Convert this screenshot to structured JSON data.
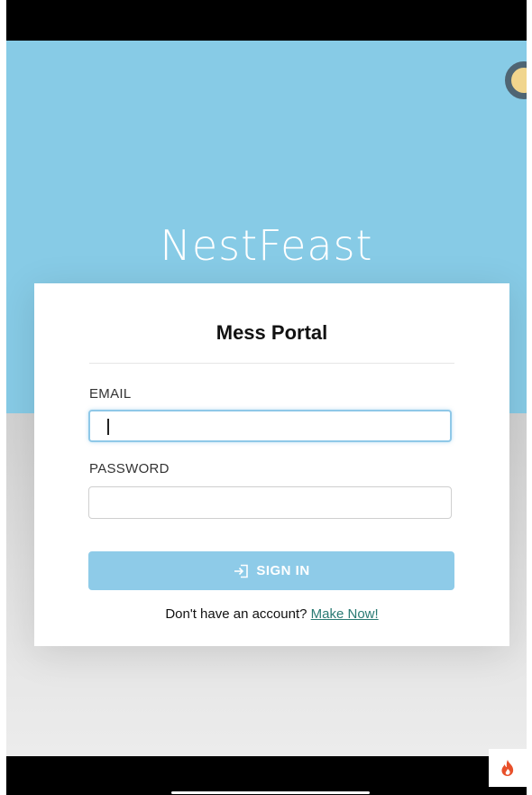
{
  "app": {
    "title": "NestFeast"
  },
  "login": {
    "heading": "Mess Portal",
    "email_label": "EMAIL",
    "email_value": "",
    "password_label": "PASSWORD",
    "password_value": "",
    "signin_label": "SIGN IN",
    "signup_prompt": "Don't have an account?",
    "signup_link": "Make Now!"
  },
  "icons": {
    "signin": "login-arrow-icon",
    "fab": "flame-icon",
    "avatar": "avatar"
  },
  "colors": {
    "hero": "#87cbe6",
    "button": "#8ecbe8",
    "link": "#2a7a73",
    "fab_icon": "#e8502a"
  }
}
